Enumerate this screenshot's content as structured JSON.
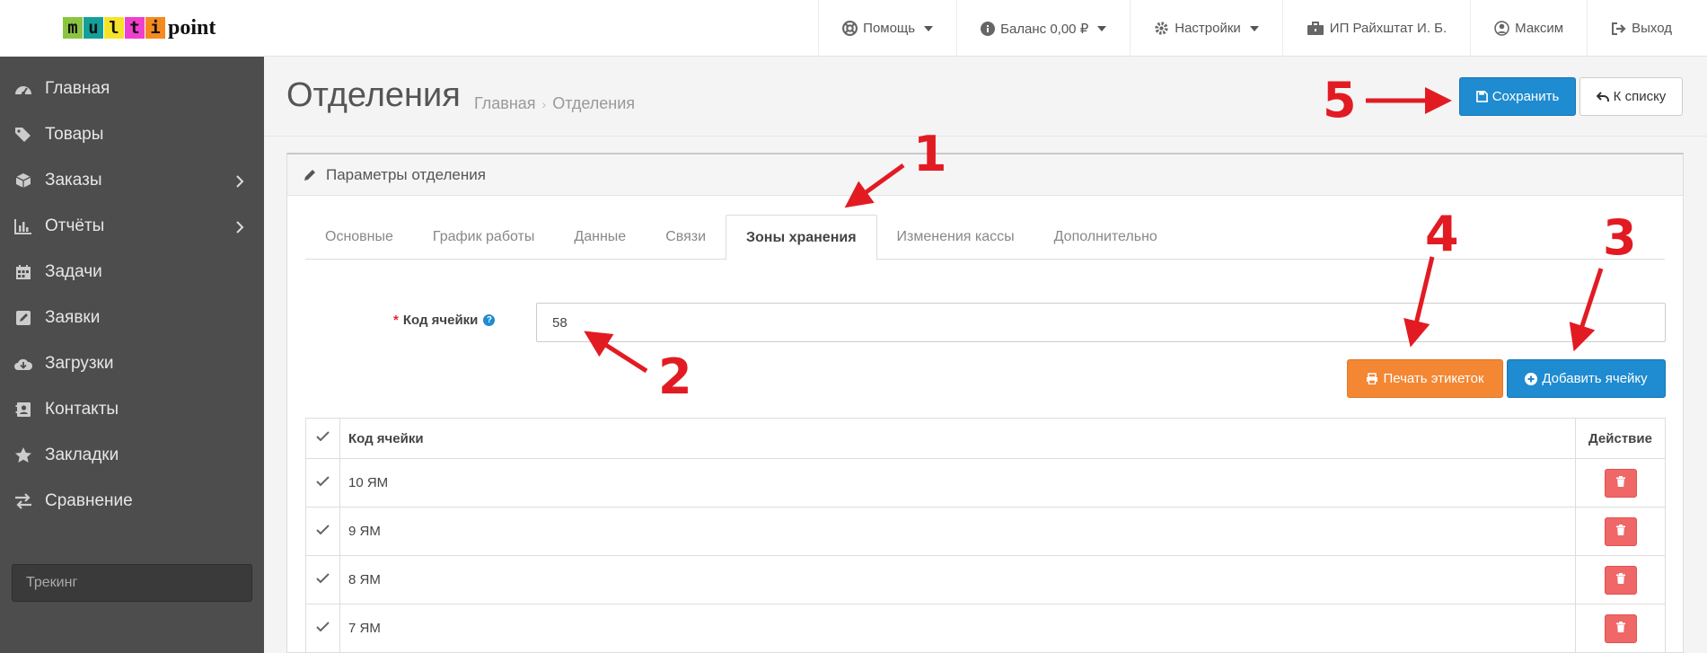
{
  "logo": {
    "letters": [
      "m",
      "u",
      "l",
      "t",
      "i"
    ],
    "letter_colors": [
      "#8bc540",
      "#14a09a",
      "#f5e32a",
      "#ef3fcf",
      "#f58a1f"
    ],
    "word": "point"
  },
  "topnav": {
    "help": "Помощь",
    "balance": "Баланс 0,00 ₽",
    "settings": "Настройки",
    "company": "ИП Райхштат И. Б.",
    "user": "Максим",
    "logout": "Выход"
  },
  "sidebar": {
    "items": [
      {
        "label": "Главная",
        "icon": "dashboard-icon"
      },
      {
        "label": "Товары",
        "icon": "tags-icon"
      },
      {
        "label": "Заказы",
        "icon": "cube-icon",
        "has_children": true
      },
      {
        "label": "Отчёты",
        "icon": "bar-chart-icon",
        "has_children": true
      },
      {
        "label": "Задачи",
        "icon": "calendar-icon"
      },
      {
        "label": "Заявки",
        "icon": "edit-icon"
      },
      {
        "label": "Загрузки",
        "icon": "cloud-download-icon"
      },
      {
        "label": "Контакты",
        "icon": "contact-icon"
      },
      {
        "label": "Закладки",
        "icon": "star-icon"
      },
      {
        "label": "Сравнение",
        "icon": "exchange-icon"
      }
    ],
    "tracking_placeholder": "Трекинг"
  },
  "page": {
    "title": "Отделения",
    "breadcrumb": [
      "Главная",
      "Отделения"
    ],
    "save_label": "Сохранить",
    "back_label": "К списку"
  },
  "panel": {
    "title": "Параметры отделения",
    "tabs": [
      "Основные",
      "График работы",
      "Данные",
      "Связи",
      "Зоны хранения",
      "Изменения кассы",
      "Дополнительно"
    ],
    "active_tab": "Зоны хранения",
    "field_label": "Код ячейки",
    "field_required_mark": "*",
    "field_value": "58",
    "print_label": "Печать этикеток",
    "add_label": "Добавить ячейку",
    "table": {
      "columns": [
        "Код ячейки",
        "Действие"
      ],
      "rows": [
        "10 ЯМ",
        "9 ЯМ",
        "8 ЯМ",
        "7 ЯМ"
      ]
    }
  },
  "annotations": [
    "1",
    "2",
    "3",
    "4",
    "5"
  ],
  "colors": {
    "accent": "#1f8bd0",
    "warning": "#f38733",
    "danger": "#ef6767",
    "sidebar": "#4d4d4d",
    "annotation": "#e21b23"
  }
}
